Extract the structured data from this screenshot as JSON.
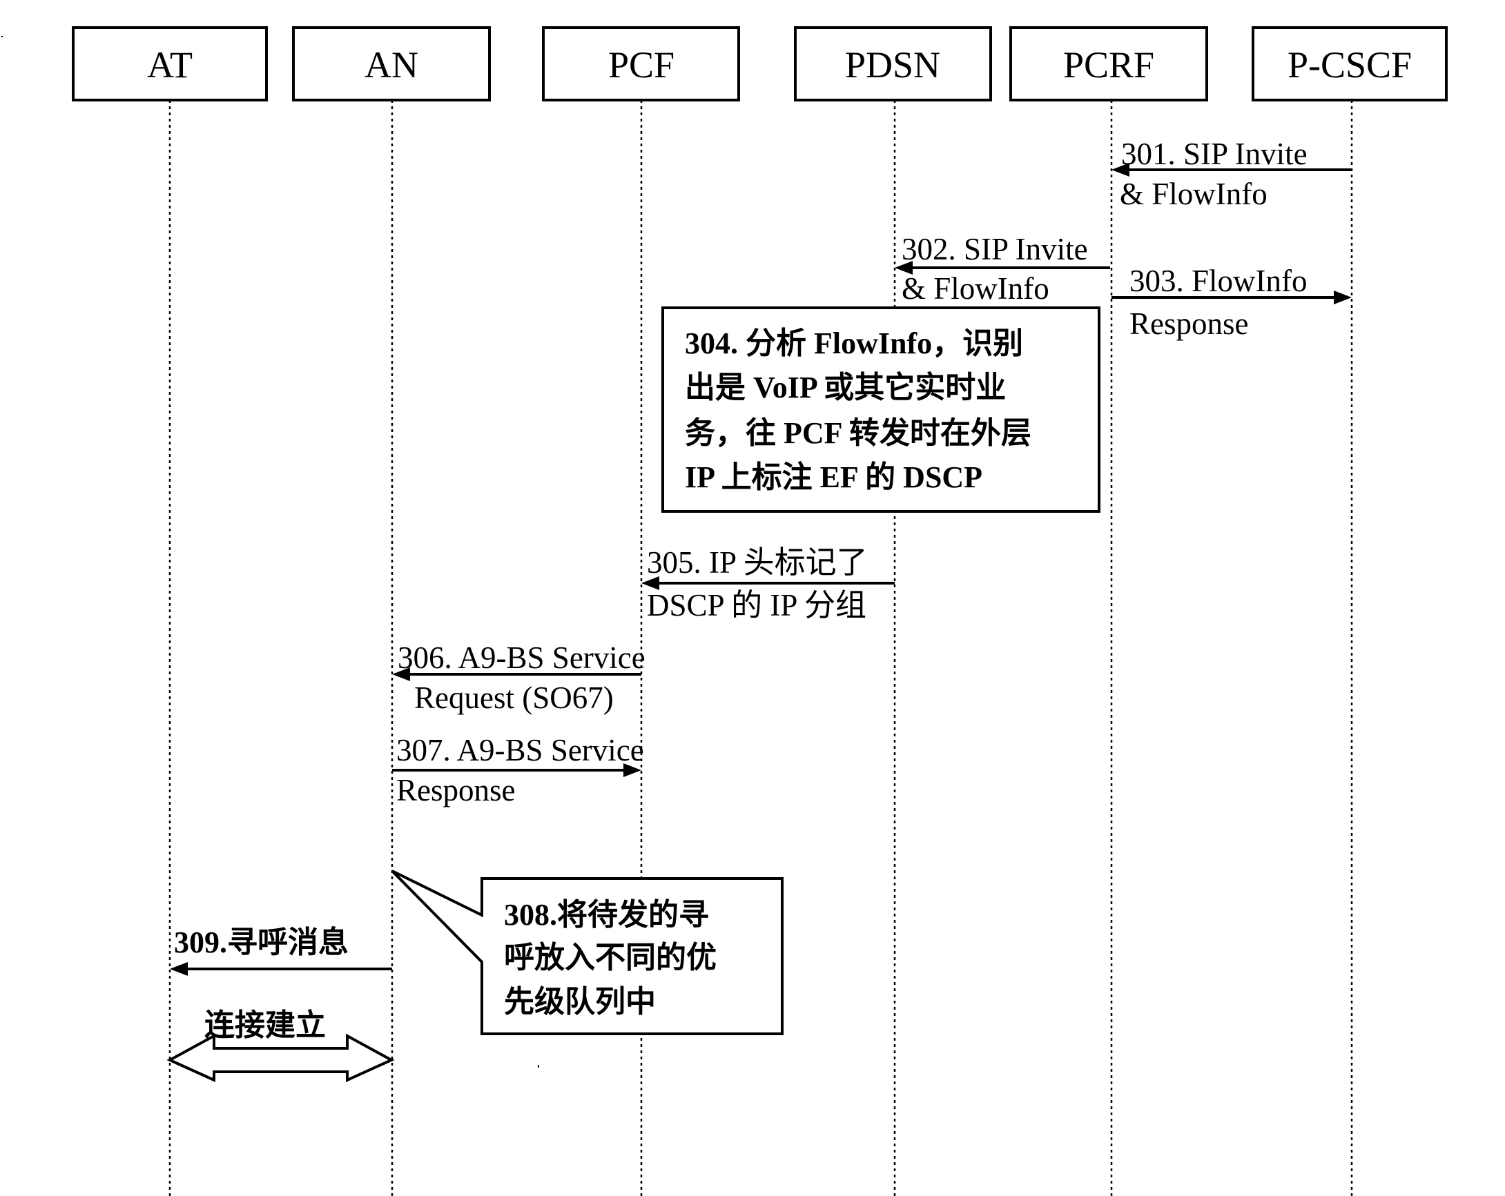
{
  "diagram": {
    "type": "sequence",
    "entities": [
      {
        "id": "AT",
        "label": "AT"
      },
      {
        "id": "AN",
        "label": "AN"
      },
      {
        "id": "PCF",
        "label": "PCF"
      },
      {
        "id": "PDSN",
        "label": "PDSN"
      },
      {
        "id": "PCRF",
        "label": "PCRF"
      },
      {
        "id": "PCSCF",
        "label": "P-CSCF"
      }
    ],
    "messages": [
      {
        "step": "301",
        "from": "PCSCF",
        "to": "PCRF",
        "lines": [
          "301. SIP Invite",
          "& FlowInfo"
        ]
      },
      {
        "step": "302",
        "from": "PCRF",
        "to": "PDSN",
        "lines": [
          "302. SIP Invite",
          "& FlowInfo"
        ]
      },
      {
        "step": "303",
        "from": "PCRF",
        "to": "PCSCF",
        "lines": [
          "303. FlowInfo",
          "Response"
        ]
      },
      {
        "step": "305",
        "from": "PDSN",
        "to": "PCF",
        "lines": [
          "305. IP 头标记了",
          "DSCP 的 IP 分组"
        ]
      },
      {
        "step": "306",
        "from": "PCF",
        "to": "AN",
        "lines": [
          "306. A9-BS Service",
          "Request (SO67)"
        ]
      },
      {
        "step": "307",
        "from": "AN",
        "to": "PCF",
        "lines": [
          "307. A9-BS Service",
          "Response"
        ]
      },
      {
        "step": "309",
        "from": "AN",
        "to": "AT",
        "lines": [
          "309.寻呼消息"
        ]
      }
    ],
    "notes": [
      {
        "step": "304",
        "at": "PDSN",
        "lines": [
          "304. 分析 FlowInfo，识别",
          "出是 VoIP 或其它实时业",
          "务，往 PCF 转发时在外层",
          "IP 上标注 EF 的 DSCP"
        ]
      },
      {
        "step": "308",
        "at": "AN",
        "lines": [
          "308.将待发的寻",
          "呼放入不同的优",
          "先级队列中"
        ]
      }
    ],
    "bidirectional": {
      "between": [
        "AT",
        "AN"
      ],
      "label": "连接建立"
    }
  }
}
